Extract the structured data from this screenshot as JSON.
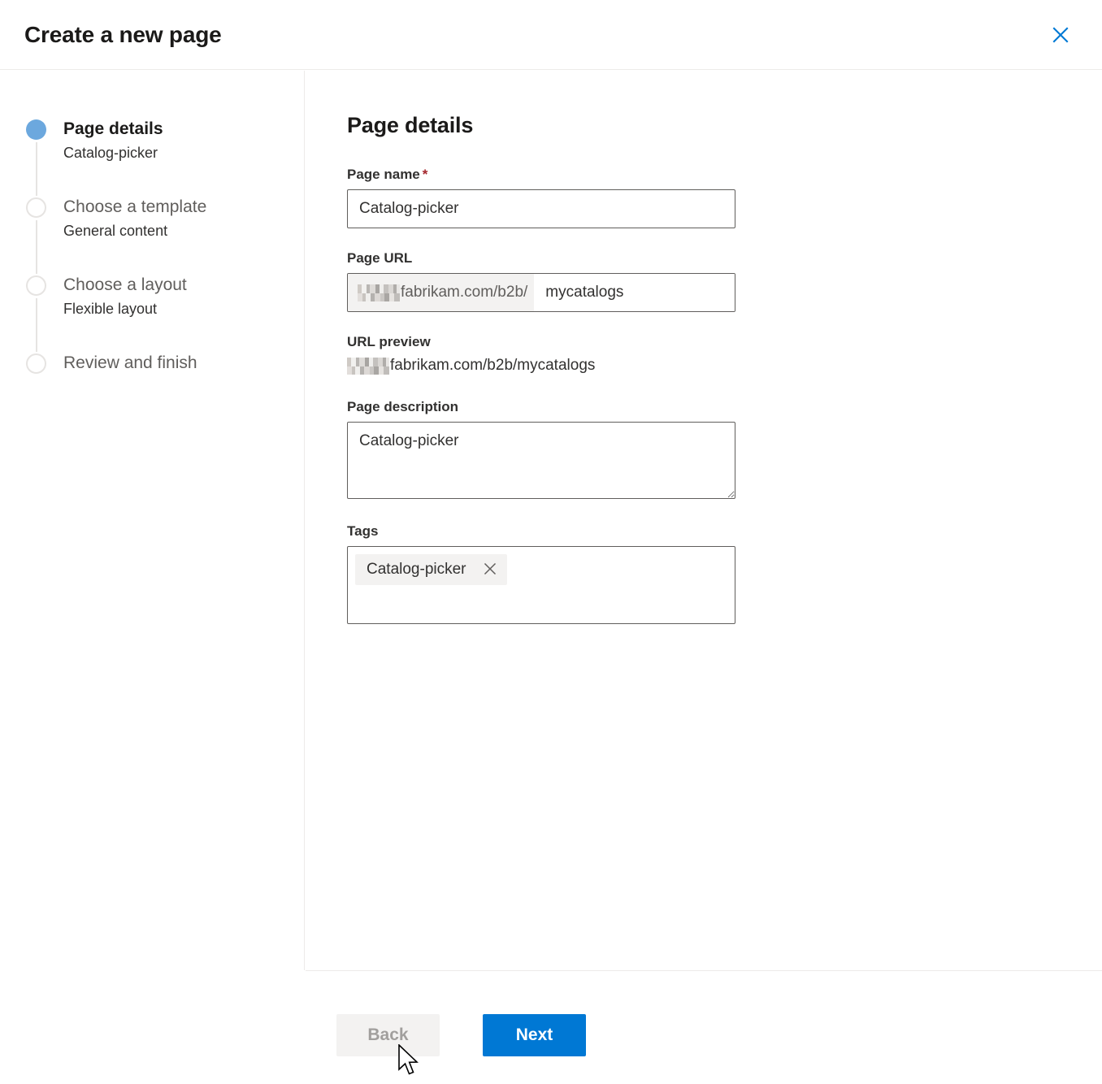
{
  "dialog": {
    "title": "Create a new page",
    "close_icon": "close-icon",
    "close_label": "Close"
  },
  "wizard": {
    "steps": [
      {
        "title": "Page details",
        "sub": "Catalog-picker",
        "state": "active"
      },
      {
        "title": "Choose a template",
        "sub": "General content",
        "state": "inactive"
      },
      {
        "title": "Choose a layout",
        "sub": "Flexible layout",
        "state": "inactive"
      },
      {
        "title": "Review and finish",
        "sub": "",
        "state": "inactive"
      }
    ]
  },
  "main": {
    "heading": "Page details",
    "page_name": {
      "label": "Page name",
      "required_marker": "*",
      "value": "Catalog-picker",
      "placeholder": ""
    },
    "page_url": {
      "label": "Page URL",
      "prefix_redacted": true,
      "prefix_text": "fabrikam.com/b2b/",
      "value": "mycatalogs",
      "placeholder": ""
    },
    "url_preview": {
      "label": "URL preview",
      "value": "fabrikam.com/b2b/mycatalogs"
    },
    "page_description": {
      "label": "Page description",
      "value": "Catalog-picker",
      "placeholder": ""
    },
    "tags": {
      "label": "Tags",
      "items": [
        {
          "label": "Catalog-picker",
          "remove_icon": "close-icon"
        }
      ]
    }
  },
  "footer": {
    "back_label": "Back",
    "back_disabled": true,
    "next_label": "Next"
  },
  "colors": {
    "accent": "#0078d4",
    "active_step": "#6ca8de",
    "required": "#a4262c",
    "disabled_text": "#a19f9d",
    "field_border": "#605e5c",
    "divider": "#edebe9",
    "chip_bg": "#f3f2f1"
  }
}
